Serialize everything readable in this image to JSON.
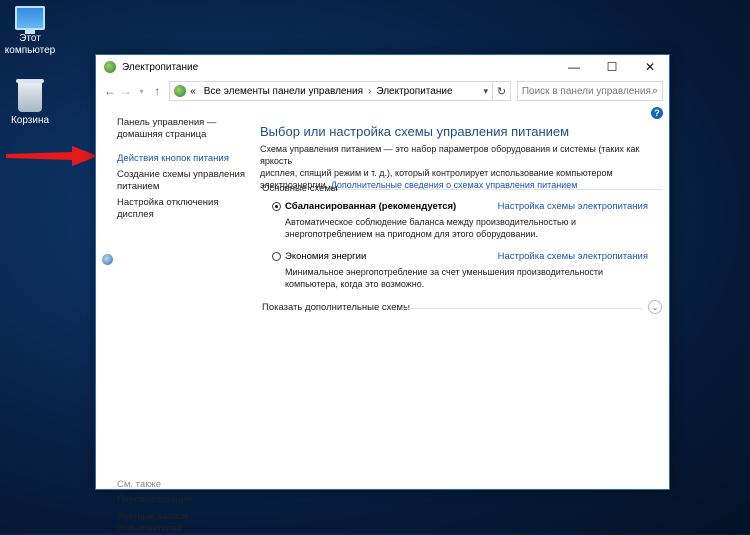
{
  "desktop": {
    "this_pc_label": "Этот компьютер",
    "recycle_bin_label": "Корзина"
  },
  "window": {
    "title": "Электропитание",
    "controls": {
      "minimize": "—",
      "maximize": "☐",
      "close": "✕"
    }
  },
  "address_bar": {
    "breadcrumb_prefix": "«",
    "breadcrumbs": [
      "Все элементы панели управления",
      "Электропитание"
    ],
    "separator": "›"
  },
  "search": {
    "placeholder": "Поиск в панели управления"
  },
  "sidebar": {
    "items": [
      {
        "label_line1": "Панель управления —",
        "label_line2": "домашняя страница"
      },
      {
        "label": "Действия кнопок питания"
      },
      {
        "label_line1": "Создание схемы управления",
        "label_line2": "питанием"
      },
      {
        "label_line1": "Настройка отключения",
        "label_line2": "дисплея"
      }
    ],
    "see_also_title": "См. также",
    "see_also": [
      {
        "label": "Персонализация"
      },
      {
        "label_line1": "Учетные записи",
        "label_line2": "пользователей"
      }
    ]
  },
  "main": {
    "heading": "Выбор или настройка схемы управления питанием",
    "description_line1": "Схема управления питанием — это набор параметров оборудования и системы (таких как яркость",
    "description_line2": "дисплея, спящий режим и т. д.), который контролирует использование компьютером",
    "description_line3_prefix": "электроэнергии. ",
    "description_link": "Дополнительные сведения о схемах управления питанием",
    "group_title": "Основные схемы",
    "plans": [
      {
        "name": "Сбалансированная (рекомендуется)",
        "selected": true,
        "link": "Настройка схемы электропитания",
        "desc_line1": "Автоматическое соблюдение баланса между производительностью и",
        "desc_line2": "энергопотреблением на пригодном для этого оборудовании."
      },
      {
        "name": "Экономия энергии",
        "selected": false,
        "link": "Настройка схемы электропитания",
        "desc_line1": "Минимальное энергопотребление за счет уменьшения производительности",
        "desc_line2": "компьютера, когда это возможно."
      }
    ],
    "more_plans_label": "Показать дополнительные схемы"
  },
  "colors": {
    "accent": "#1a56b8",
    "heading": "#1e4e8c",
    "arrow": "#e31b1b"
  }
}
